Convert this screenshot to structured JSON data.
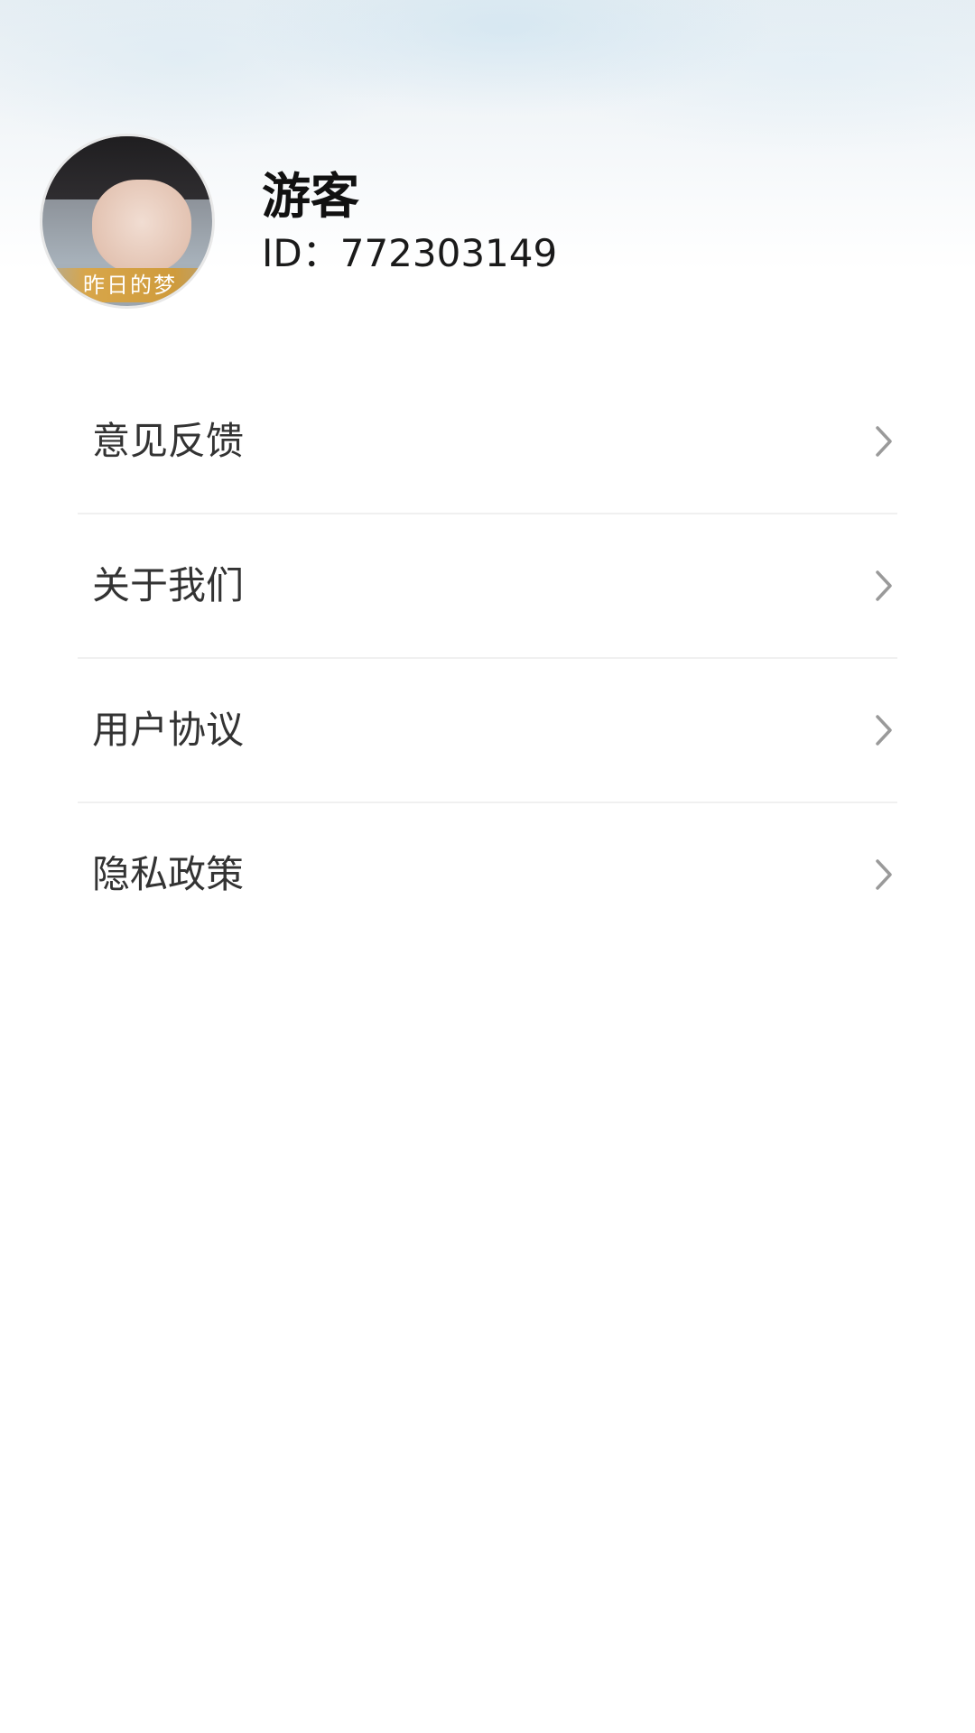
{
  "profile": {
    "name": "游客",
    "id_text": "ID：772303149",
    "avatar_caption": "昨日的梦"
  },
  "menu": {
    "items": [
      {
        "label": "意见反馈",
        "icon": "chevron-right-icon"
      },
      {
        "label": "关于我们",
        "icon": "chevron-right-icon"
      },
      {
        "label": "用户协议",
        "icon": "chevron-right-icon"
      },
      {
        "label": "隐私政策",
        "icon": "chevron-right-icon"
      }
    ]
  },
  "colors": {
    "background": "#ffffff",
    "divider": "#f0f0f0",
    "chevron": "#9a9a9a",
    "text_primary": "#111111",
    "text_menu": "#333333"
  }
}
